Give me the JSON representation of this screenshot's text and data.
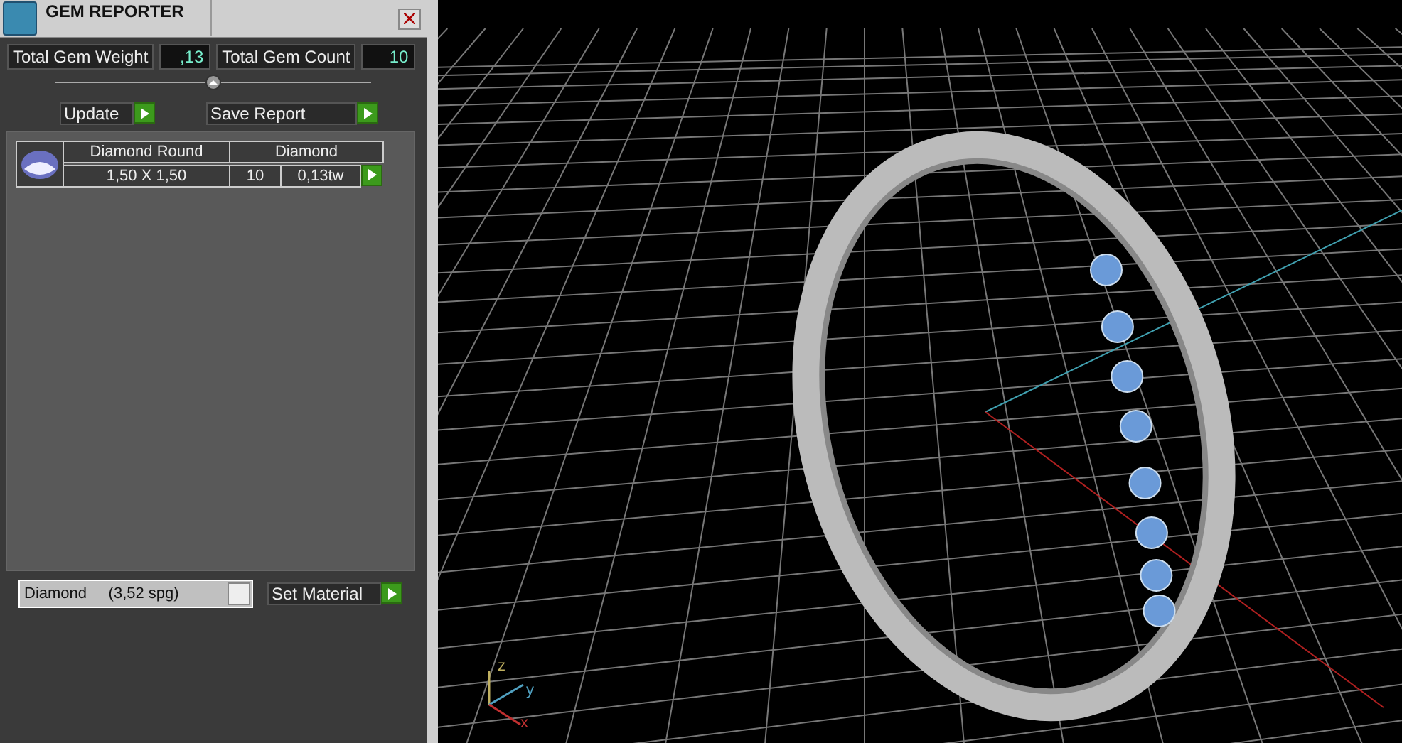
{
  "panel": {
    "title": "GEM REPORTER",
    "totals": [
      {
        "label": "Total Gem Weight",
        "value": ",13"
      },
      {
        "label": "Total Gem Count",
        "value": "10"
      }
    ],
    "actions": [
      "Update",
      "Save Report"
    ],
    "gems": [
      {
        "name": "Diamond Round",
        "material": "Diamond",
        "size": "1,50 X 1,50",
        "count": "10",
        "weight": "0,13tw"
      }
    ],
    "material_select": {
      "value": "Diamond     (3,52 spg)"
    },
    "set_button": "Set Material"
  },
  "viewport": {
    "axes": [
      {
        "kind": "z",
        "label": "z"
      },
      {
        "kind": "y",
        "label": "y"
      },
      {
        "kind": "x",
        "label": "x"
      }
    ]
  }
}
